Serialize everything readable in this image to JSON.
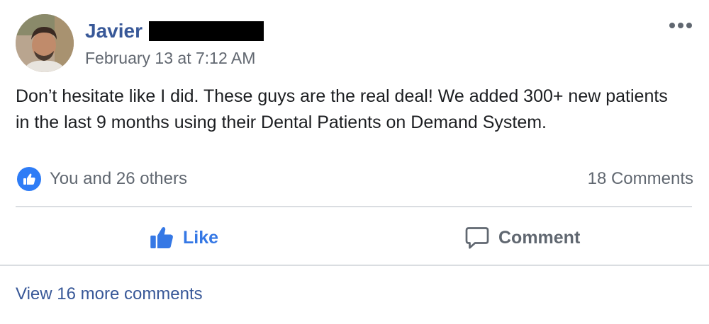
{
  "post": {
    "author_name": "Javier",
    "timestamp": "February 13 at 7:12 AM",
    "text": "Don’t hesitate like I did. These guys are the real deal! We added 300+ new patients in the last 9 months using their Dental Patients on Demand System."
  },
  "reactions": {
    "summary": "You and 26 others",
    "comments_count": "18 Comments"
  },
  "actions": {
    "like_label": "Like",
    "comment_label": "Comment"
  },
  "comments": {
    "view_more_label": "View 16 more comments"
  },
  "colors": {
    "author_link": "#385898",
    "like_blue": "#3578e5",
    "badge_blue": "#2e7cf6",
    "muted_text": "#606770",
    "divider": "#dadde1"
  },
  "icons": {
    "more": "more-dots-icon",
    "like_badge": "thumbs-up-icon",
    "like_action": "thumbs-up-icon",
    "comment_action": "speech-bubble-icon"
  }
}
